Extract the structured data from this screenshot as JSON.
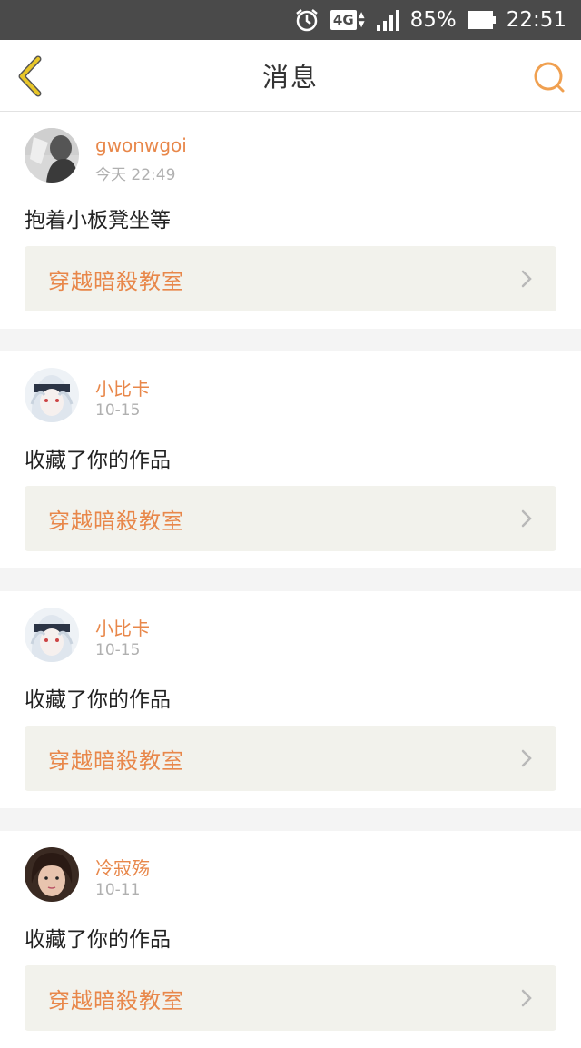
{
  "status_bar": {
    "network": "4G",
    "battery": "85%",
    "time": "22:51",
    "icons": [
      "alarm-icon",
      "signal-icon",
      "battery-icon"
    ]
  },
  "header": {
    "title": "消息",
    "back_icon": "chevron-left-icon",
    "search_icon": "search-icon"
  },
  "colors": {
    "accent": "#e8874a",
    "back_arrow": "#e8c628",
    "status_bar_bg": "#4a4a4a",
    "link_bg": "#f2f2ec"
  },
  "messages": [
    {
      "name": "gwonwgoi",
      "time": "今天 22:49",
      "text": "抱着小板凳坐等",
      "work": "穿越暗殺教室"
    },
    {
      "name": "小比卡",
      "time": "10-15",
      "text": "收藏了你的作品",
      "work": "穿越暗殺教室"
    },
    {
      "name": "小比卡",
      "time": "10-15",
      "text": "收藏了你的作品",
      "work": "穿越暗殺教室"
    },
    {
      "name": "冷寂殇",
      "time": "10-11",
      "text": "收藏了你的作品",
      "work": "穿越暗殺教室"
    }
  ]
}
